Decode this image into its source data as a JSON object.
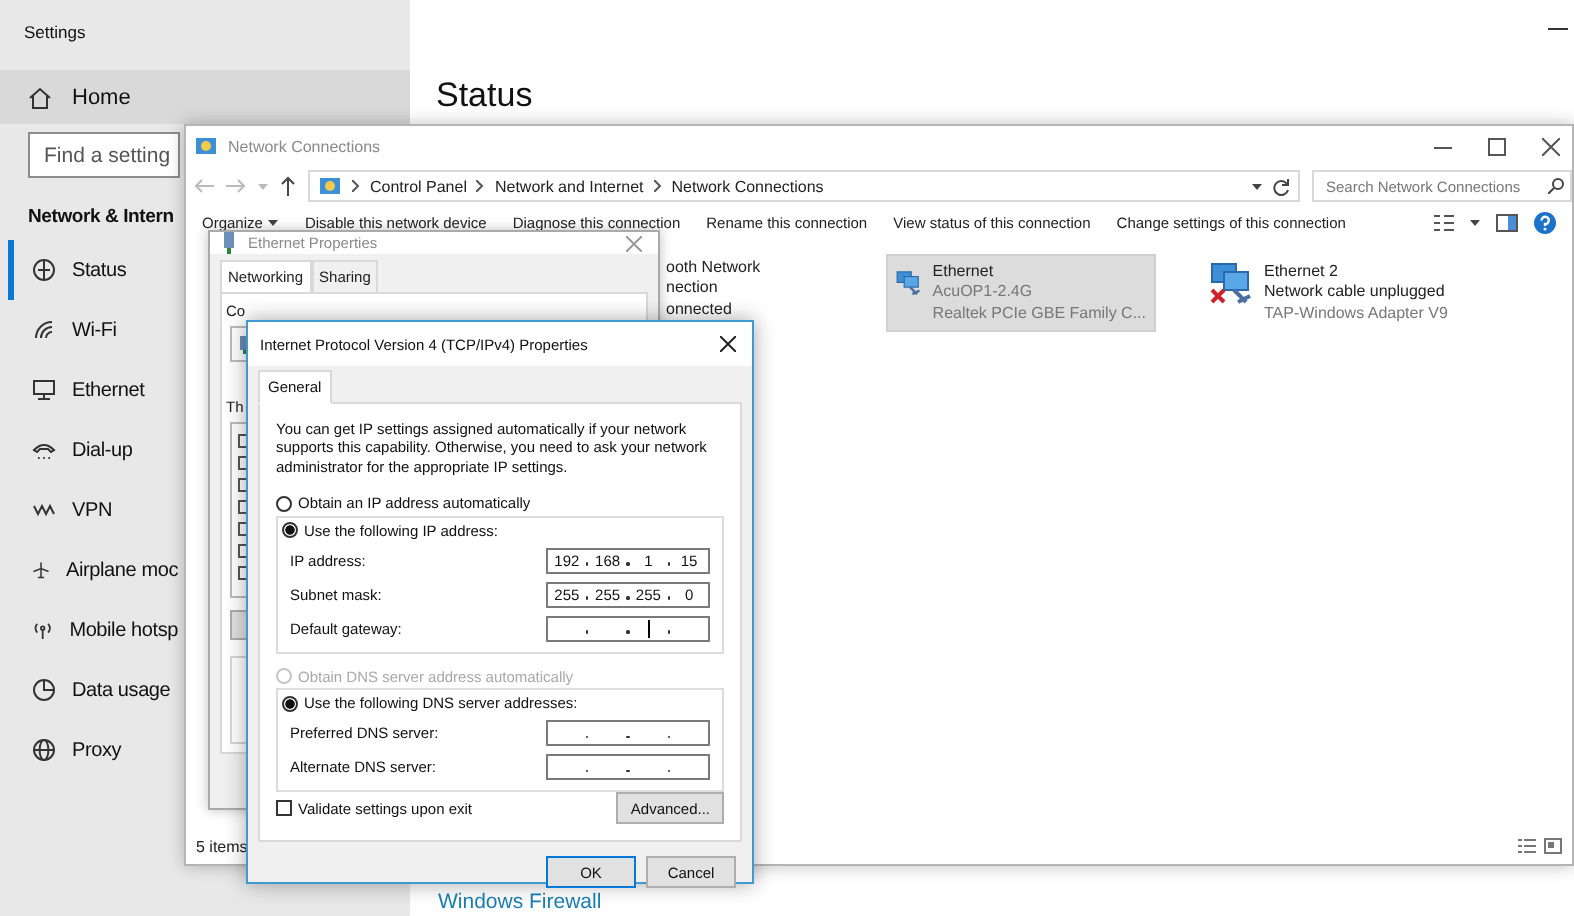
{
  "settings": {
    "title": "Settings",
    "home": "Home",
    "search": {
      "placeholder": "Find a setting"
    },
    "section": "Network & Intern",
    "nav": [
      {
        "label": "Status",
        "selected": true
      },
      {
        "label": "Wi-Fi",
        "selected": false
      },
      {
        "label": "Ethernet",
        "selected": false
      },
      {
        "label": "Dial-up",
        "selected": false
      },
      {
        "label": "VPN",
        "selected": false
      },
      {
        "label": "Airplane moc",
        "selected": false
      },
      {
        "label": "Mobile hotsp",
        "selected": false
      },
      {
        "label": "Data usage",
        "selected": false
      },
      {
        "label": "Proxy",
        "selected": false
      }
    ],
    "heading": "Status",
    "link": "Windows Firewall"
  },
  "network_connections": {
    "title": "Network Connections",
    "breadcrumb": [
      "Control Panel",
      "Network and Internet",
      "Network Connections"
    ],
    "search": {
      "placeholder": "Search Network Connections"
    },
    "commands": [
      "Organize",
      "Disable this network device",
      "Diagnose this connection",
      "Rename this connection",
      "View status of this connection",
      "Change settings of this connection"
    ],
    "items": [
      {
        "kind": "partial",
        "lines": [
          "ooth Network",
          "nection",
          "onnected"
        ],
        "selected": false
      },
      {
        "kind": "adapter",
        "name": "Ethernet",
        "status": "AcuOP1-2.4G",
        "device": "Realtek PCIe GBE Family C...",
        "selected": true,
        "unplugged": false
      },
      {
        "kind": "adapter",
        "name": "Ethernet 2",
        "status": "Network cable unplugged",
        "device": "TAP-Windows Adapter V9",
        "selected": false,
        "unplugged": true
      }
    ],
    "status_bar": "5 items"
  },
  "ethernet_properties": {
    "title": "Ethernet Properties",
    "tabs": [
      {
        "label": "Networking",
        "selected": true
      },
      {
        "label": "Sharing",
        "selected": false
      }
    ],
    "partial_labels": [
      "Co",
      "Th"
    ]
  },
  "ipv4_properties": {
    "title": "Internet Protocol Version 4 (TCP/IPv4) Properties",
    "tabs": [
      {
        "label": "General",
        "selected": true
      }
    ],
    "intro": "You can get IP settings assigned automatically if your network supports this capability. Otherwise, you need to ask your network administrator for the appropriate IP settings.",
    "ip_mode": [
      {
        "label": "Obtain an IP address automatically",
        "selected": false,
        "disabled": false
      },
      {
        "label": "Use the following IP address:",
        "selected": true,
        "disabled": false
      }
    ],
    "ip_fields": [
      {
        "label": "IP address:",
        "octets": [
          "192",
          "168",
          "1",
          "15"
        ],
        "focused": false
      },
      {
        "label": "Subnet mask:",
        "octets": [
          "255",
          "255",
          "255",
          "0"
        ],
        "focused": false
      },
      {
        "label": "Default gateway:",
        "focused": true
      }
    ],
    "dns_mode": [
      {
        "label": "Obtain DNS server address automatically",
        "selected": false,
        "disabled": true
      },
      {
        "label": "Use the following DNS server addresses:",
        "selected": true,
        "disabled": false
      }
    ],
    "dns_fields": [
      {
        "label": "Preferred DNS server:",
        "focused": false
      },
      {
        "label": "Alternate DNS server:",
        "focused": false
      }
    ],
    "validate": {
      "label": "Validate settings upon exit",
      "checked": false
    },
    "advanced": "Advanced...",
    "buttons": [
      {
        "label": "OK",
        "default": true
      },
      {
        "label": "Cancel",
        "default": false
      }
    ]
  }
}
